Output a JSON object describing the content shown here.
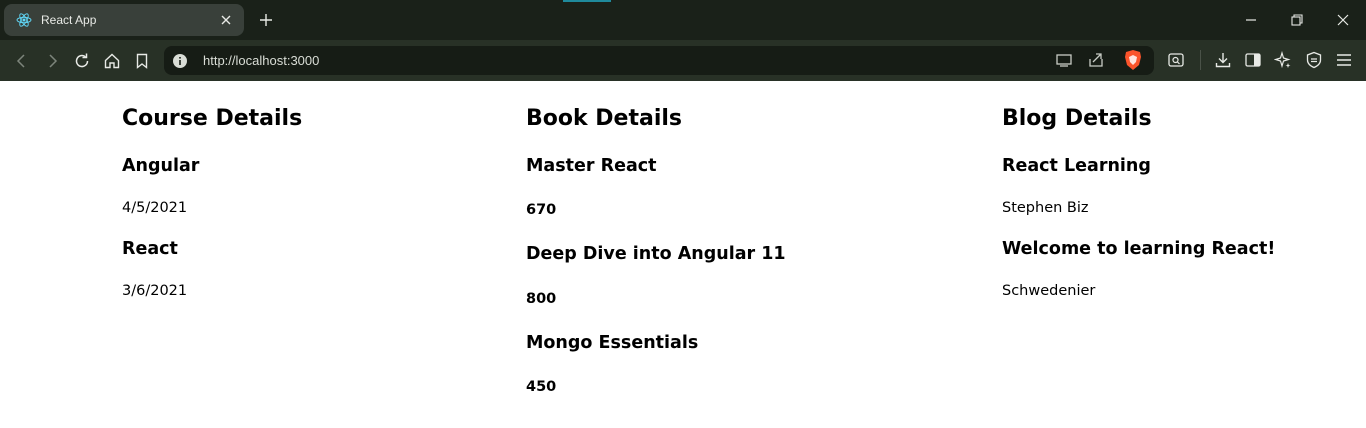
{
  "browser": {
    "tab": {
      "title": "React App",
      "icon": "react-logo-icon"
    },
    "url": "http://localhost:3000",
    "colors": {
      "titlebar": "#1a2119",
      "toolbar": "#283126",
      "tab_active": "#39403a",
      "accent": "#1f8a9c"
    }
  },
  "course": {
    "heading": "Course Details",
    "items": [
      {
        "name": "Angular",
        "date": "4/5/2021"
      },
      {
        "name": "React",
        "date": "3/6/2021"
      }
    ]
  },
  "book": {
    "heading": "Book Details",
    "items": [
      {
        "name": "Master React",
        "price": "670"
      },
      {
        "name": "Deep Dive into Angular 11",
        "price": "800"
      },
      {
        "name": "Mongo Essentials",
        "price": "450"
      }
    ]
  },
  "blog": {
    "heading": "Blog Details",
    "items": [
      {
        "title": "React Learning",
        "author": "Stephen Biz"
      },
      {
        "title": "Welcome to learning React!",
        "author": "Schwedenier"
      }
    ]
  }
}
